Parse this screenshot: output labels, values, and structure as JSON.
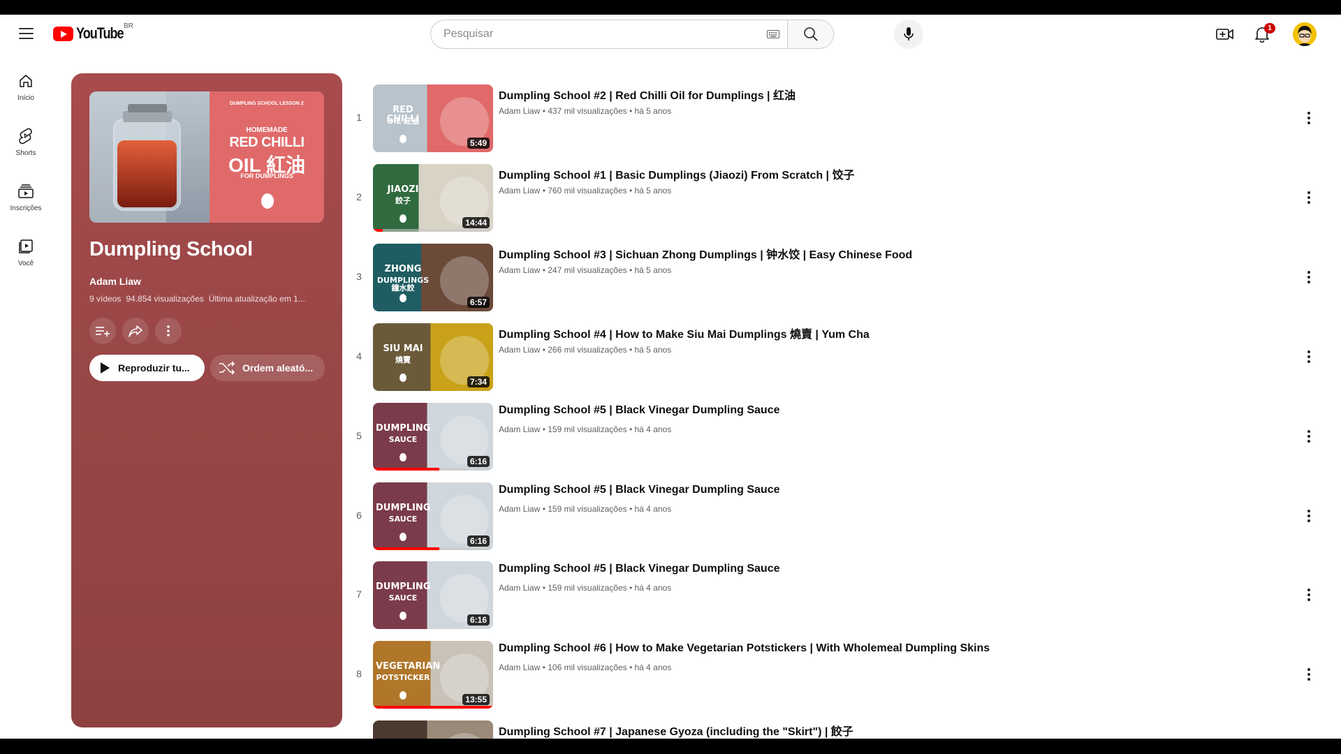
{
  "header": {
    "logo_text": "YouTube",
    "country_code": "BR",
    "search_placeholder": "Pesquisar",
    "notification_count": "1"
  },
  "leftnav": [
    {
      "label": "Início",
      "icon": "home-icon"
    },
    {
      "label": "Shorts",
      "icon": "shorts-icon"
    },
    {
      "label": "Inscrições",
      "icon": "subscriptions-icon"
    },
    {
      "label": "Você",
      "icon": "you-icon"
    }
  ],
  "playlist": {
    "thumb_caption_top": "DUMPLING SCHOOL LESSON 2",
    "thumb_caption_mid": "HOMEMADE",
    "thumb_caption_big1": "RED CHILLI",
    "thumb_caption_big2": "OIL 紅油",
    "thumb_caption_bot": "FOR DUMPLINGS",
    "title": "Dumpling School",
    "author": "Adam Liaw",
    "video_count": "9 vídeos",
    "views": "94.854 visualizações",
    "updated": "Última atualização em 1...",
    "play_all_label": "Reproduzir tu...",
    "shuffle_label": "Ordem aleató..."
  },
  "videos": [
    {
      "n": "1",
      "title": "Dumpling School #2 | Red Chilli Oil for Dumplings | 红油",
      "meta": "Adam Liaw • 437 mil visualizações • há 5 anos",
      "duration": "5:49",
      "progress": 0,
      "theme": "chilli",
      "cap1": "RED CHILLI",
      "cap2": "OIL 紅油"
    },
    {
      "n": "2",
      "title": "Dumpling School #1 | Basic Dumplings (Jiaozi) From Scratch | 饺子",
      "meta": "Adam Liaw • 760 mil visualizações • há 5 anos",
      "duration": "14:44",
      "progress": 0.08,
      "theme": "jiaozi",
      "cap1": "JIAOZI",
      "cap2": "餃子"
    },
    {
      "n": "3",
      "title": "Dumpling School #3 | Sichuan Zhong Dumplings | 钟水饺 | Easy Chinese Food",
      "meta": "Adam Liaw • 247 mil visualizações • há 5 anos",
      "duration": "6:57",
      "progress": 0,
      "theme": "zhong",
      "cap1": "ZHONG",
      "cap2": "DUMPLINGS 鐘水餃"
    },
    {
      "n": "4",
      "title": "Dumpling School #4 | How to Make Siu Mai Dumplings 燒賣 | Yum Cha",
      "meta": "Adam Liaw • 266 mil visualizações • há 5 anos",
      "duration": "7:34",
      "progress": 0,
      "theme": "siumai",
      "cap1": "SIU MAI",
      "cap2": "燒賣"
    },
    {
      "n": "5",
      "title": "Dumpling School #5 | Black Vinegar Dumpling Sauce",
      "meta": "Adam Liaw • 159 mil visualizações • há 4 anos",
      "duration": "6:16",
      "progress": 0.55,
      "theme": "sauce",
      "cap1": "DUMPLING",
      "cap2": "SAUCE"
    },
    {
      "n": "6",
      "title": "Dumpling School #5 | Black Vinegar Dumpling Sauce",
      "meta": "Adam Liaw • 159 mil visualizações • há 4 anos",
      "duration": "6:16",
      "progress": 0.55,
      "theme": "sauce",
      "cap1": "DUMPLING",
      "cap2": "SAUCE"
    },
    {
      "n": "7",
      "title": "Dumpling School #5 | Black Vinegar Dumpling Sauce",
      "meta": "Adam Liaw • 159 mil visualizações • há 4 anos",
      "duration": "6:16",
      "progress": 0,
      "theme": "sauce",
      "cap1": "DUMPLING",
      "cap2": "SAUCE"
    },
    {
      "n": "8",
      "title": "Dumpling School #6 | How to Make Vegetarian Potstickers | With Wholemeal Dumpling Skins",
      "meta": "Adam Liaw • 106 mil visualizações • há 4 anos",
      "duration": "13:55",
      "progress": 1.0,
      "theme": "potsticker",
      "cap1": "VEGETARIAN",
      "cap2": "POTSTICKER"
    },
    {
      "n": "",
      "title": "Dumpling School #7 | Japanese Gyoza (including the \"Skirt\") | 餃子",
      "meta": "",
      "duration": "",
      "progress": 0,
      "theme": "gyoza",
      "cap1": "",
      "cap2": ""
    }
  ],
  "colors": {
    "accent": "#ff0000",
    "panel": "#9a4748"
  }
}
